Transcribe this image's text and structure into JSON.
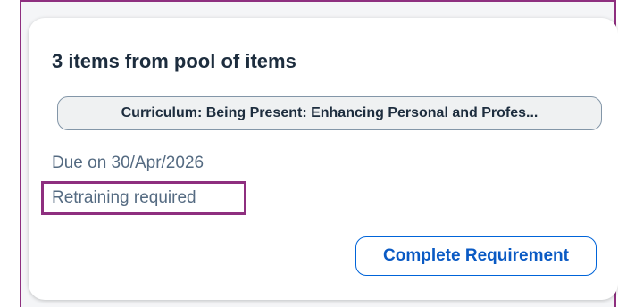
{
  "card": {
    "title": "3 items from pool of items",
    "item_pill_label": "Curriculum: Being Present: Enhancing Personal and Profes...",
    "due_text": "Due on 30/Apr/2026",
    "retraining_text": "Retraining required",
    "complete_button_label": "Complete Requirement"
  },
  "colors": {
    "highlight_border": "#8e2f7f",
    "title_text": "#1d2d3e",
    "secondary_text": "#556b82",
    "button_text": "#0a5ac4",
    "button_border": "#0064d9",
    "pill_background": "#eff1f2",
    "pill_border": "#8396a8"
  }
}
